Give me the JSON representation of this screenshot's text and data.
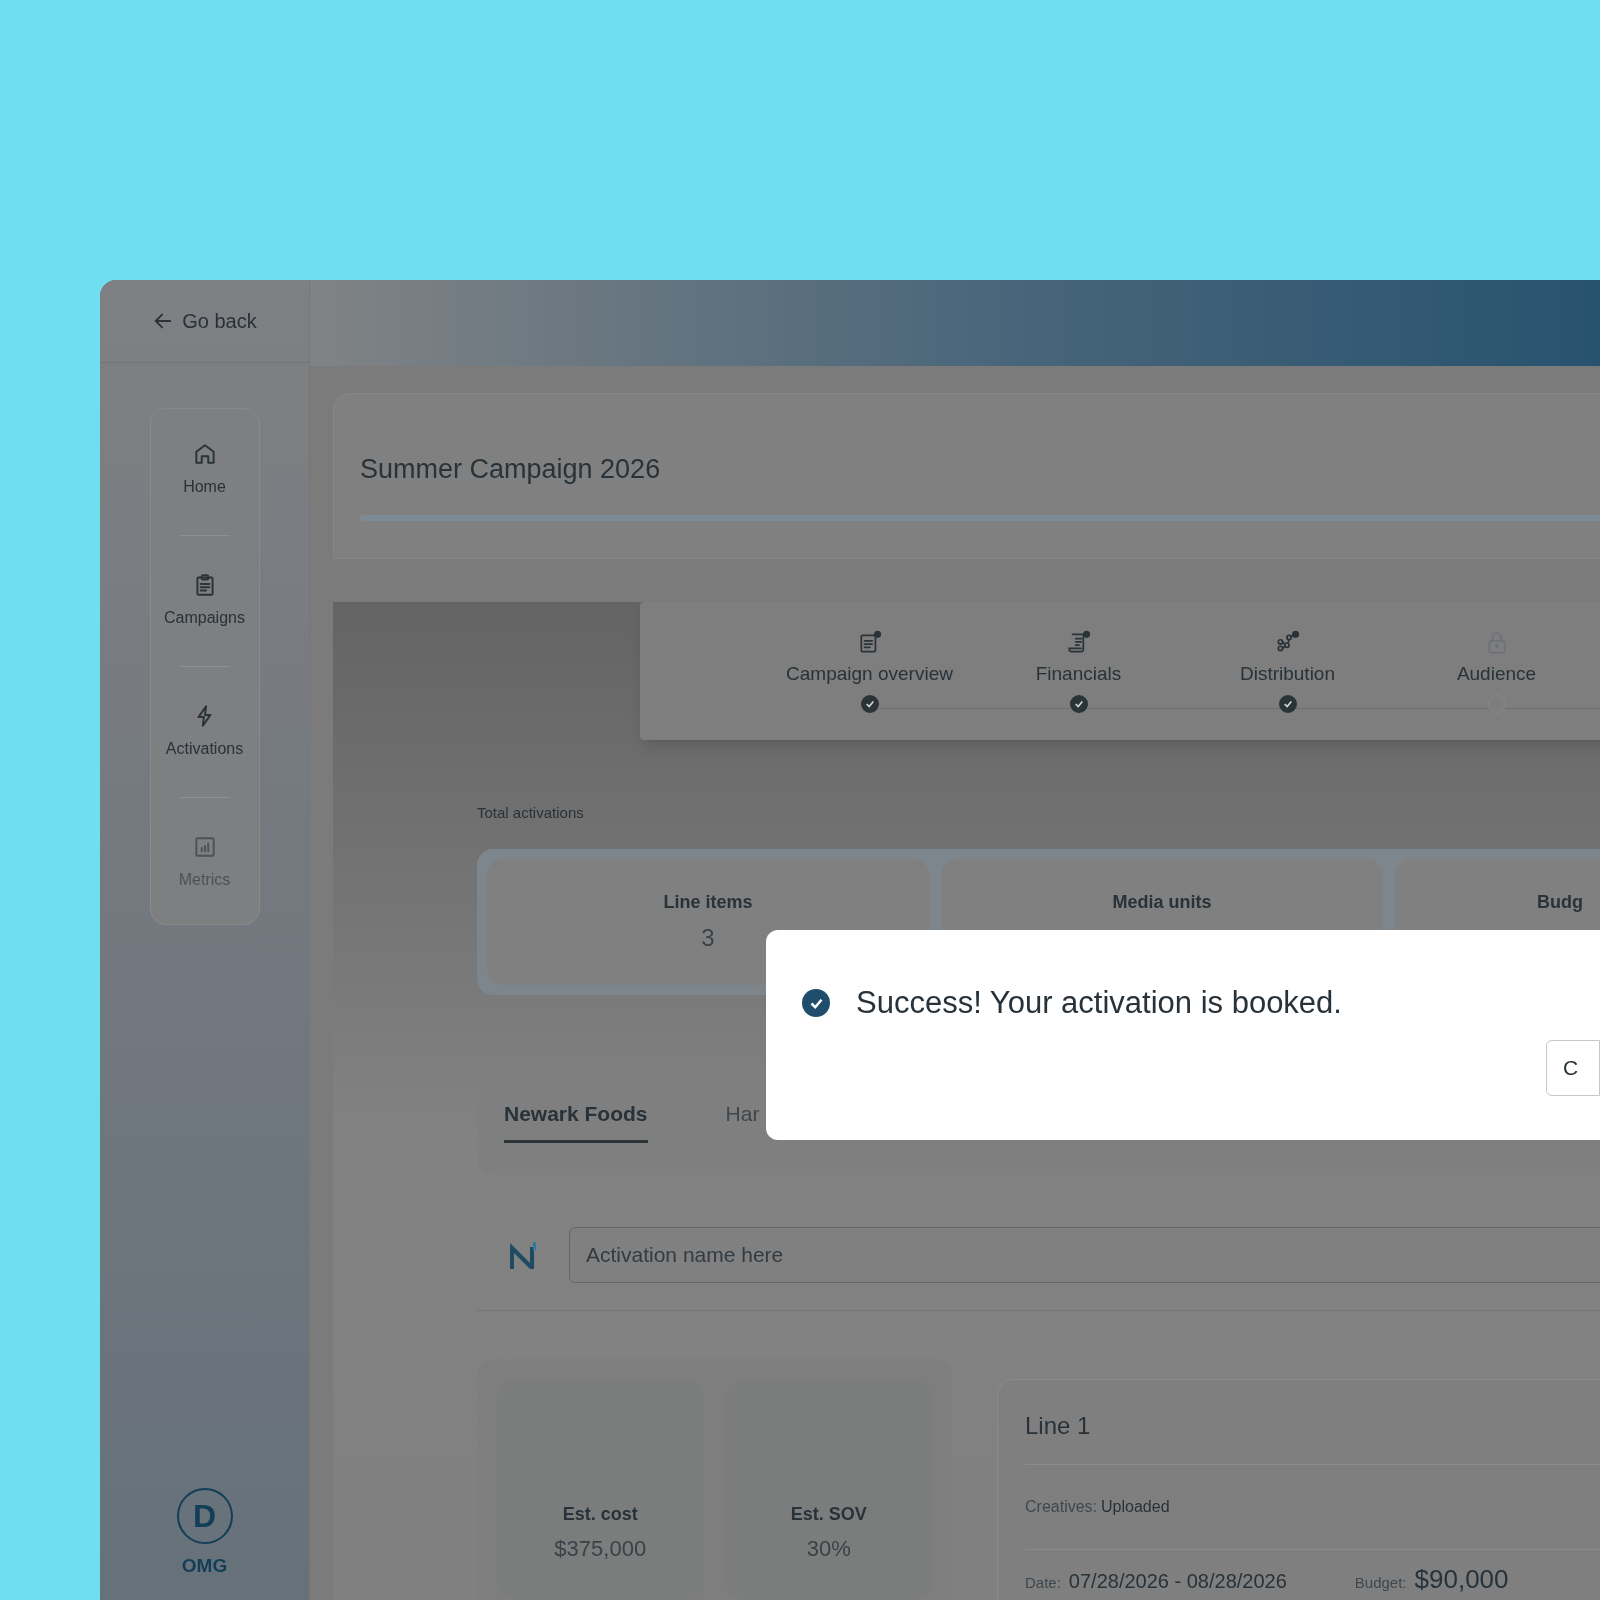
{
  "sidebar": {
    "back_link": "Go back",
    "items": [
      {
        "label": "Home",
        "disabled": false
      },
      {
        "label": "Campaigns",
        "disabled": false
      },
      {
        "label": "Activations",
        "disabled": false
      },
      {
        "label": "Metrics",
        "disabled": true
      }
    ],
    "brand": {
      "initial": "D",
      "name": "OMG"
    }
  },
  "campaign": {
    "title": "Summer Campaign 2026"
  },
  "stepper": [
    {
      "label": "Campaign overview",
      "done": true
    },
    {
      "label": "Financials",
      "done": true
    },
    {
      "label": "Distribution",
      "done": true
    },
    {
      "label": "Audience",
      "done": false
    }
  ],
  "totals": {
    "heading": "Total activations",
    "cards": [
      {
        "label": "Line items",
        "value": "3"
      },
      {
        "label": "Media units"
      },
      {
        "label": "Budg"
      }
    ]
  },
  "tabs": [
    {
      "label": "Newark Foods",
      "selected": true
    },
    {
      "label": "Har",
      "selected": false
    }
  ],
  "activation_name": {
    "placeholder": "Activation name here"
  },
  "estimates": [
    {
      "label": "Est. cost",
      "value": "$375,000"
    },
    {
      "label": "Est. SOV",
      "value": "30%"
    }
  ],
  "line": {
    "title": "Line 1",
    "creatives_label": "Creatives:",
    "creatives_value": "Uploaded",
    "date_label": "Date:",
    "date_value": "07/28/2026 - 08/28/2026",
    "budget_label": "Budget:",
    "budget_value": "$90,000"
  },
  "modal": {
    "message": "Success! Your activation is booked.",
    "button": "C"
  }
}
